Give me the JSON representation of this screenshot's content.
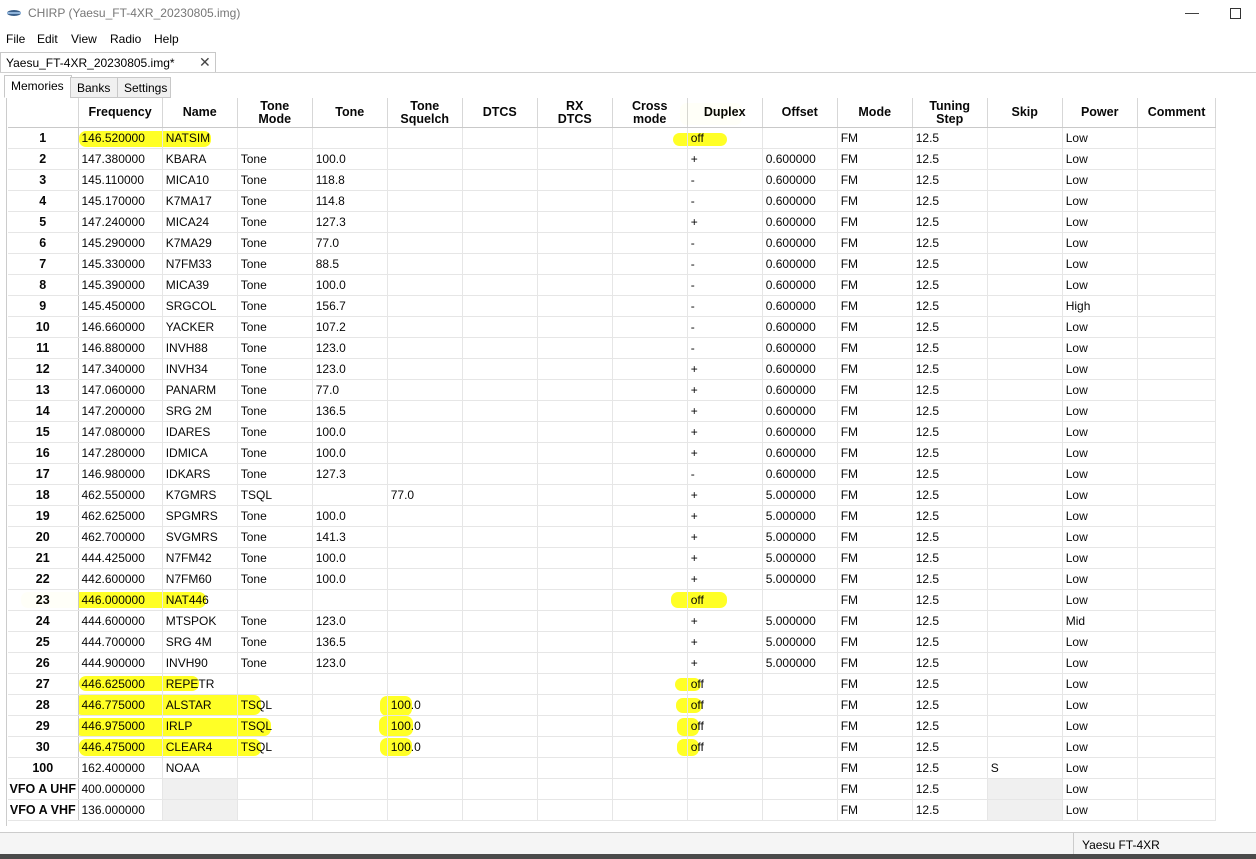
{
  "window": {
    "title": "CHIRP (Yaesu_FT-4XR_20230805.img)",
    "minimize_glyph": "—",
    "accent_color": "#ffff00"
  },
  "menu": [
    "File",
    "Edit",
    "View",
    "Radio",
    "Help"
  ],
  "file_tab": {
    "label": "Yaesu_FT-4XR_20230805.img*",
    "close_glyph": "✕"
  },
  "tabs": [
    "Memories",
    "Banks",
    "Settings"
  ],
  "columns": [
    "Frequency",
    "Name",
    "Tone Mode",
    "Tone",
    "Tone Squelch",
    "DTCS",
    "RX DTCS",
    "Cross mode",
    "Duplex",
    "Offset",
    "Mode",
    "Tuning Step",
    "Skip",
    "Power",
    "Comment"
  ],
  "rows": [
    [
      "1",
      "146.520000",
      "NATSIM",
      "",
      "",
      "",
      "",
      "",
      "",
      "off",
      "",
      "FM",
      "12.5",
      "",
      "Low",
      ""
    ],
    [
      "2",
      "147.380000",
      "KBARA",
      "Tone",
      "100.0",
      "",
      "",
      "",
      "",
      "+",
      "0.600000",
      "FM",
      "12.5",
      "",
      "Low",
      ""
    ],
    [
      "3",
      "145.110000",
      "MICA10",
      "Tone",
      "118.8",
      "",
      "",
      "",
      "",
      "-",
      "0.600000",
      "FM",
      "12.5",
      "",
      "Low",
      ""
    ],
    [
      "4",
      "145.170000",
      "K7MA17",
      "Tone",
      "114.8",
      "",
      "",
      "",
      "",
      "-",
      "0.600000",
      "FM",
      "12.5",
      "",
      "Low",
      ""
    ],
    [
      "5",
      "147.240000",
      "MICA24",
      "Tone",
      "127.3",
      "",
      "",
      "",
      "",
      "+",
      "0.600000",
      "FM",
      "12.5",
      "",
      "Low",
      ""
    ],
    [
      "6",
      "145.290000",
      "K7MA29",
      "Tone",
      "77.0",
      "",
      "",
      "",
      "",
      "-",
      "0.600000",
      "FM",
      "12.5",
      "",
      "Low",
      ""
    ],
    [
      "7",
      "145.330000",
      "N7FM33",
      "Tone",
      "88.5",
      "",
      "",
      "",
      "",
      "-",
      "0.600000",
      "FM",
      "12.5",
      "",
      "Low",
      ""
    ],
    [
      "8",
      "145.390000",
      "MICA39",
      "Tone",
      "100.0",
      "",
      "",
      "",
      "",
      "-",
      "0.600000",
      "FM",
      "12.5",
      "",
      "Low",
      ""
    ],
    [
      "9",
      "145.450000",
      "SRGCOL",
      "Tone",
      "156.7",
      "",
      "",
      "",
      "",
      "-",
      "0.600000",
      "FM",
      "12.5",
      "",
      "High",
      ""
    ],
    [
      "10",
      "146.660000",
      "YACKER",
      "Tone",
      "107.2",
      "",
      "",
      "",
      "",
      "-",
      "0.600000",
      "FM",
      "12.5",
      "",
      "Low",
      ""
    ],
    [
      "11",
      "146.880000",
      "INVH88",
      "Tone",
      "123.0",
      "",
      "",
      "",
      "",
      "-",
      "0.600000",
      "FM",
      "12.5",
      "",
      "Low",
      ""
    ],
    [
      "12",
      "147.340000",
      "INVH34",
      "Tone",
      "123.0",
      "",
      "",
      "",
      "",
      "+",
      "0.600000",
      "FM",
      "12.5",
      "",
      "Low",
      ""
    ],
    [
      "13",
      "147.060000",
      "PANARM",
      "Tone",
      "77.0",
      "",
      "",
      "",
      "",
      "+",
      "0.600000",
      "FM",
      "12.5",
      "",
      "Low",
      ""
    ],
    [
      "14",
      "147.200000",
      "SRG 2M",
      "Tone",
      "136.5",
      "",
      "",
      "",
      "",
      "+",
      "0.600000",
      "FM",
      "12.5",
      "",
      "Low",
      ""
    ],
    [
      "15",
      "147.080000",
      "IDARES",
      "Tone",
      "100.0",
      "",
      "",
      "",
      "",
      "+",
      "0.600000",
      "FM",
      "12.5",
      "",
      "Low",
      ""
    ],
    [
      "16",
      "147.280000",
      "IDMICA",
      "Tone",
      "100.0",
      "",
      "",
      "",
      "",
      "+",
      "0.600000",
      "FM",
      "12.5",
      "",
      "Low",
      ""
    ],
    [
      "17",
      "146.980000",
      "IDKARS",
      "Tone",
      "127.3",
      "",
      "",
      "",
      "",
      "-",
      "0.600000",
      "FM",
      "12.5",
      "",
      "Low",
      ""
    ],
    [
      "18",
      "462.550000",
      "K7GMRS",
      "TSQL",
      "",
      "77.0",
      "",
      "",
      "",
      "+",
      "5.000000",
      "FM",
      "12.5",
      "",
      "Low",
      ""
    ],
    [
      "19",
      "462.625000",
      "SPGMRS",
      "Tone",
      "100.0",
      "",
      "",
      "",
      "",
      "+",
      "5.000000",
      "FM",
      "12.5",
      "",
      "Low",
      ""
    ],
    [
      "20",
      "462.700000",
      "SVGMRS",
      "Tone",
      "141.3",
      "",
      "",
      "",
      "",
      "+",
      "5.000000",
      "FM",
      "12.5",
      "",
      "Low",
      ""
    ],
    [
      "21",
      "444.425000",
      "N7FM42",
      "Tone",
      "100.0",
      "",
      "",
      "",
      "",
      "+",
      "5.000000",
      "FM",
      "12.5",
      "",
      "Low",
      ""
    ],
    [
      "22",
      "442.600000",
      "N7FM60",
      "Tone",
      "100.0",
      "",
      "",
      "",
      "",
      "+",
      "5.000000",
      "FM",
      "12.5",
      "",
      "Low",
      ""
    ],
    [
      "23",
      "446.000000",
      "NAT446",
      "",
      "",
      "",
      "",
      "",
      "",
      "off",
      "",
      "FM",
      "12.5",
      "",
      "Low",
      ""
    ],
    [
      "24",
      "444.600000",
      "MTSPOK",
      "Tone",
      "123.0",
      "",
      "",
      "",
      "",
      "+",
      "5.000000",
      "FM",
      "12.5",
      "",
      "Mid",
      ""
    ],
    [
      "25",
      "444.700000",
      "SRG 4M",
      "Tone",
      "136.5",
      "",
      "",
      "",
      "",
      "+",
      "5.000000",
      "FM",
      "12.5",
      "",
      "Low",
      ""
    ],
    [
      "26",
      "444.900000",
      "INVH90",
      "Tone",
      "123.0",
      "",
      "",
      "",
      "",
      "+",
      "5.000000",
      "FM",
      "12.5",
      "",
      "Low",
      ""
    ],
    [
      "27",
      "446.625000",
      "REPETR",
      "",
      "",
      "",
      "",
      "",
      "",
      "off",
      "",
      "FM",
      "12.5",
      "",
      "Low",
      ""
    ],
    [
      "28",
      "446.775000",
      "ALSTAR",
      "TSQL",
      "",
      "100.0",
      "",
      "",
      "",
      "off",
      "",
      "FM",
      "12.5",
      "",
      "Low",
      ""
    ],
    [
      "29",
      "446.975000",
      "IRLP",
      "TSQL",
      "",
      "100.0",
      "",
      "",
      "",
      "off",
      "",
      "FM",
      "12.5",
      "",
      "Low",
      ""
    ],
    [
      "30",
      "446.475000",
      "CLEAR4",
      "TSQL",
      "",
      "100.0",
      "",
      "",
      "",
      "off",
      "",
      "FM",
      "12.5",
      "",
      "Low",
      ""
    ],
    [
      "100",
      "162.400000",
      "NOAA",
      "",
      "",
      "",
      "",
      "",
      "",
      "",
      "",
      "FM",
      "12.5",
      "S",
      "Low",
      ""
    ],
    [
      "VFO A UHF",
      "400.000000",
      "",
      "",
      "",
      "",
      "",
      "",
      "",
      "",
      "",
      "FM",
      "12.5",
      "",
      "Low",
      ""
    ],
    [
      "VFO A VHF",
      "136.000000",
      "",
      "",
      "",
      "",
      "",
      "",
      "",
      "",
      "",
      "FM",
      "12.5",
      "",
      "Low",
      ""
    ]
  ],
  "status": {
    "radio_model": "Yaesu FT-4XR"
  }
}
